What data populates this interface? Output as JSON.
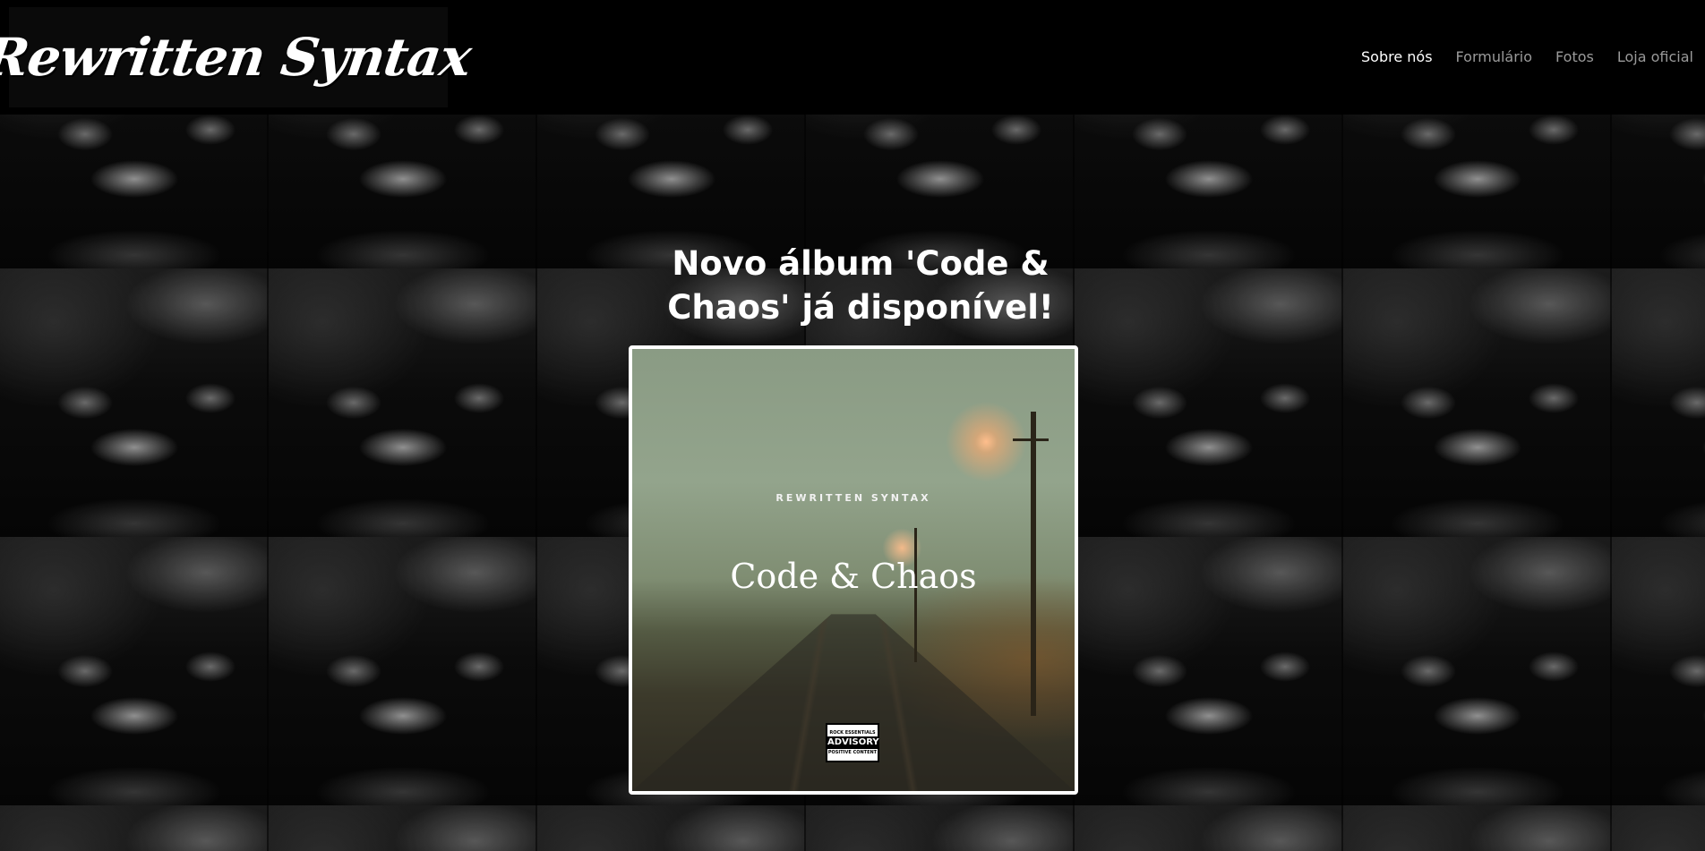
{
  "header": {
    "logo_text": "Rewritten Syntax",
    "nav": [
      {
        "label": "Sobre nós",
        "active": true
      },
      {
        "label": "Formulário",
        "active": false
      },
      {
        "label": "Fotos",
        "active": false
      },
      {
        "label": "Loja oficial",
        "active": false
      }
    ]
  },
  "hero": {
    "title": "Novo álbum 'Code & Chaos' já disponível!"
  },
  "album_cover": {
    "band_name": "REWRITTEN SYNTAX",
    "album_title": "Code & Chaos",
    "advisory": {
      "top": "ROCK ESSENTIALS",
      "middle": "ADVISORY",
      "bottom": "POSITIVE CONTENT"
    }
  }
}
